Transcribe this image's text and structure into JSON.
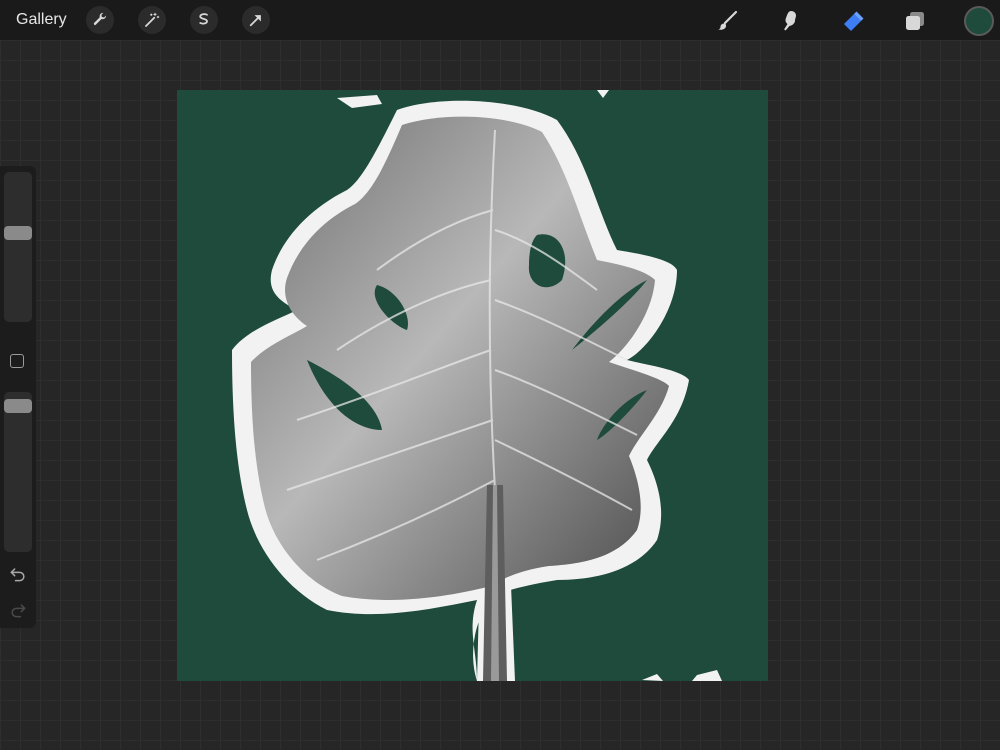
{
  "topbar": {
    "gallery_label": "Gallery",
    "left_tools": [
      "wrench-icon",
      "magic-wand-icon",
      "selection-icon",
      "transform-arrow-icon"
    ],
    "right_tools": [
      "brush-icon",
      "smudge-icon",
      "eraser-icon",
      "layers-icon"
    ],
    "active_tool": "eraser",
    "current_color": "#1e4b3c"
  },
  "sidebar": {
    "brush_size_level": 0.6,
    "opacity_level": 0.95
  },
  "canvas": {
    "background_color": "#1e4b3c",
    "subject": "monstera-leaf"
  },
  "colors": {
    "accent_blue": "#3d7ef5",
    "toolbar_bg": "#1a1a1a",
    "workspace_bg": "#262626"
  }
}
